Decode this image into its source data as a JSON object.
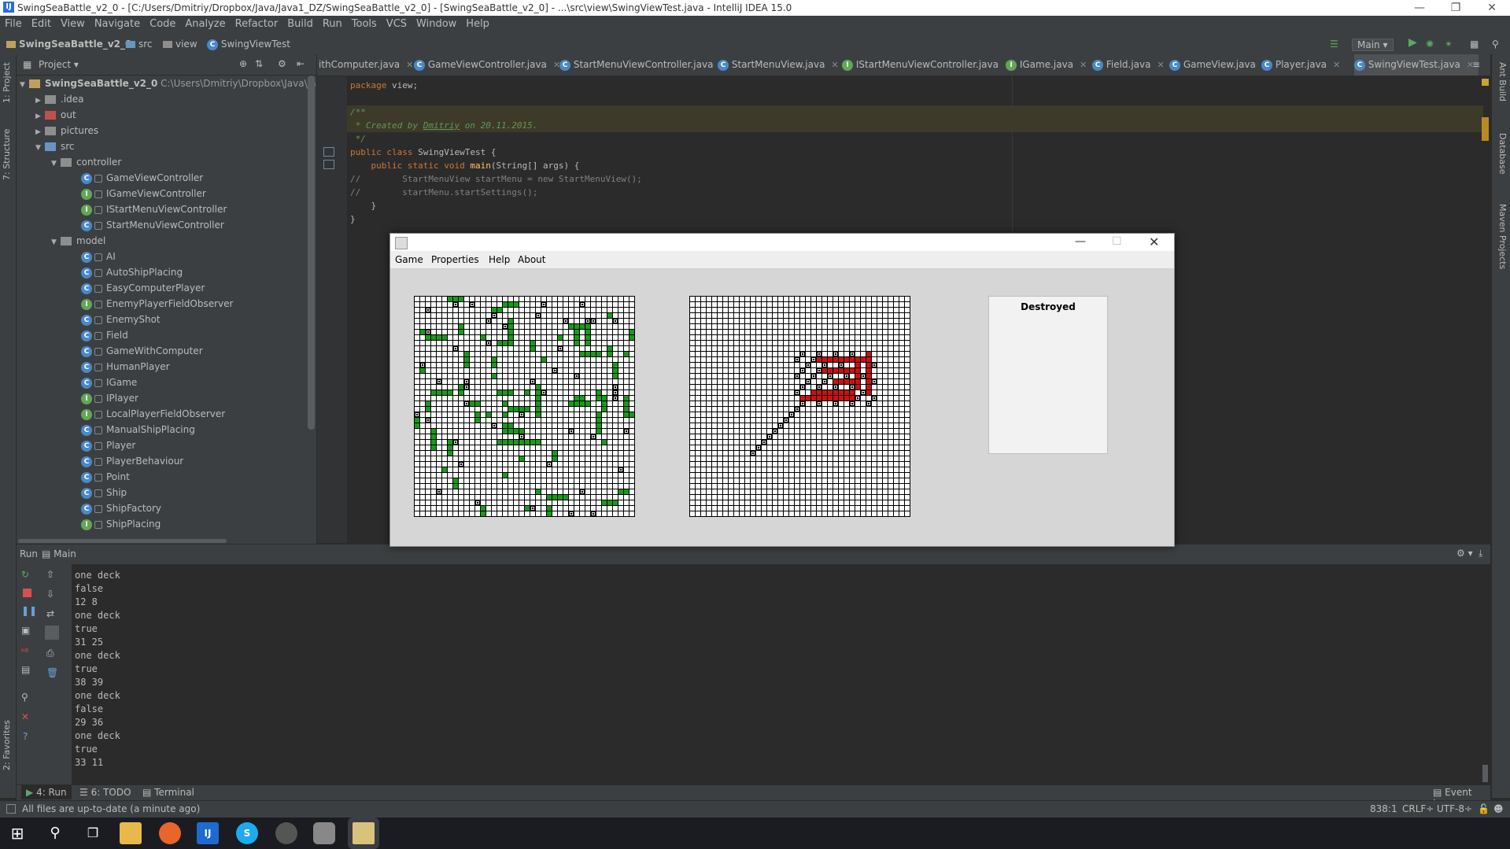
{
  "title_bar": {
    "title": "SwingSeaBattle_v2_0 - [C:/Users/Dmitriy/Dropbox/Java/Java1_DZ/SwingSeaBattle_v2_0] - [SwingSeaBattle_v2_0] - ...\\src\\view\\SwingViewTest.java - IntelliJ IDEA 15.0"
  },
  "menu": [
    "File",
    "Edit",
    "View",
    "Navigate",
    "Code",
    "Analyze",
    "Refactor",
    "Build",
    "Run",
    "Tools",
    "VCS",
    "Window",
    "Help"
  ],
  "breadcrumbs": [
    "SwingSeaBattle_v2_0",
    "src",
    "view",
    "SwingViewTest"
  ],
  "run_config": "Main",
  "project_panel": {
    "header": "Project",
    "root": "SwingSeaBattle_v2_0",
    "root_path": "C:\\Users\\Dmitriy\\Dropbox\\Java\\Java1",
    "items": [
      {
        "label": "idea",
        "kind": "folder"
      },
      {
        "label": "out",
        "kind": "folder-red"
      },
      {
        "label": "pictures",
        "kind": "folder"
      },
      {
        "label": "src",
        "kind": "folder-src"
      },
      {
        "label": "controller",
        "kind": "package"
      },
      {
        "label": "GameViewController",
        "kind": "class"
      },
      {
        "label": "IGameViewController",
        "kind": "interface"
      },
      {
        "label": "IStartMenuViewController",
        "kind": "interface"
      },
      {
        "label": "StartMenuViewController",
        "kind": "class"
      },
      {
        "label": "model",
        "kind": "package"
      },
      {
        "label": "AI",
        "kind": "class"
      },
      {
        "label": "AutoShipPlacing",
        "kind": "class"
      },
      {
        "label": "EasyComputerPlayer",
        "kind": "class"
      },
      {
        "label": "EnemyPlayerFieldObserver",
        "kind": "interface"
      },
      {
        "label": "EnemyShot",
        "kind": "class"
      },
      {
        "label": "Field",
        "kind": "class"
      },
      {
        "label": "GameWithComputer",
        "kind": "class"
      },
      {
        "label": "HumanPlayer",
        "kind": "class"
      },
      {
        "label": "IGame",
        "kind": "interface"
      },
      {
        "label": "IPlayer",
        "kind": "interface"
      },
      {
        "label": "LocalPlayerFieldObserver",
        "kind": "interface"
      },
      {
        "label": "ManualShipPlacing",
        "kind": "class"
      },
      {
        "label": "Player",
        "kind": "class"
      },
      {
        "label": "PlayerBehaviour",
        "kind": "class"
      },
      {
        "label": "Point",
        "kind": "class"
      },
      {
        "label": "Ship",
        "kind": "class"
      },
      {
        "label": "ShipFactory",
        "kind": "class"
      },
      {
        "label": "ShipPlacing",
        "kind": "interface"
      }
    ]
  },
  "editor_tabs": [
    "ithComputer.java",
    "GameViewController.java",
    "StartMenuViewController.java",
    "StartMenuView.java",
    "IStartMenuViewController.java",
    "IGame.java",
    "Field.java",
    "GameView.java",
    "Player.java",
    "SwingViewTest.java"
  ],
  "code": {
    "l1_kw": "package",
    "l1_rest": " view;",
    "l3": "/**",
    "l4_a": " * Created by ",
    "l4_b": "Dmitriy",
    "l4_c": " on 20.11.2015.",
    "l5": " */",
    "l6_kw": "public class",
    "l6_rest": " SwingViewTest {",
    "l7_kw": "    public static void",
    "l7_fn": " main",
    "l7_rest": "(String[] args) {",
    "l8": "//        StartMenuView startMenu = new StartMenuView();",
    "l9": "//        startMenu.startSettings();",
    "l10": "    }",
    "l11": "}"
  },
  "swing_window": {
    "menu": [
      "Game",
      "Properties",
      "Help",
      "About"
    ],
    "destroyed_label": "Destroyed"
  },
  "run_panel": {
    "tab": "Run",
    "config": "Main",
    "output": [
      "one deck",
      "false",
      "12 8",
      "one deck",
      "true",
      "31 25",
      "one deck",
      "true",
      "38 39",
      "one deck",
      "false",
      "29 36",
      "one deck",
      "true",
      "33 11"
    ]
  },
  "bottom_tabs": [
    "4: Run",
    "6: TODO",
    "Terminal"
  ],
  "event_log": "Event Log",
  "status": {
    "message": "All files are up-to-date (a minute ago)",
    "position": "838:1",
    "line_sep": "CRLF÷",
    "encoding": "UTF-8÷"
  },
  "side_tabs": {
    "left": [
      "1: Project",
      "7: Structure",
      "2: Favorites"
    ],
    "right": [
      "Ant Build",
      "Database",
      "Maven Projects"
    ]
  },
  "colors": {
    "ship_green": "#1a9a1a",
    "hit_red": "#cc1111",
    "ide_bg": "#2b2b2b",
    "panel_bg": "#3c3f41"
  }
}
